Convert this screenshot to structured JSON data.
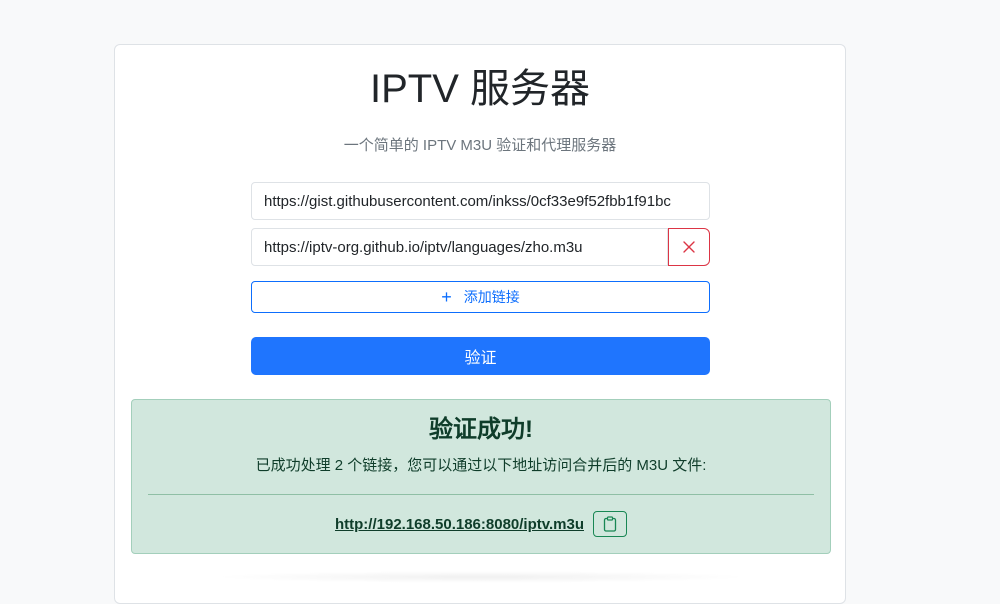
{
  "header": {
    "title": "IPTV 服务器",
    "subtitle": "一个简单的 IPTV M3U 验证和代理服务器"
  },
  "form": {
    "urls": [
      {
        "value": "https://gist.githubusercontent.com/inkss/0cf33e9f52fbb1f91bc"
      },
      {
        "value": "https://iptv-org.github.io/iptv/languages/zho.m3u"
      }
    ],
    "add_label": "添加链接",
    "verify_label": "验证"
  },
  "result": {
    "title": "验证成功!",
    "message": "已成功处理 2 个链接，您可以通过以下地址访问合并后的 M3U 文件:",
    "link": "http://192.168.50.186:8080/iptv.m3u"
  },
  "icons": {
    "remove": "close-icon",
    "add": "plus-icon",
    "copy": "clipboard-icon"
  },
  "colors": {
    "primary": "#1f75fe",
    "danger": "#dc3545",
    "success_bg": "#d1e7dd",
    "success_text": "#0f3d2a"
  }
}
